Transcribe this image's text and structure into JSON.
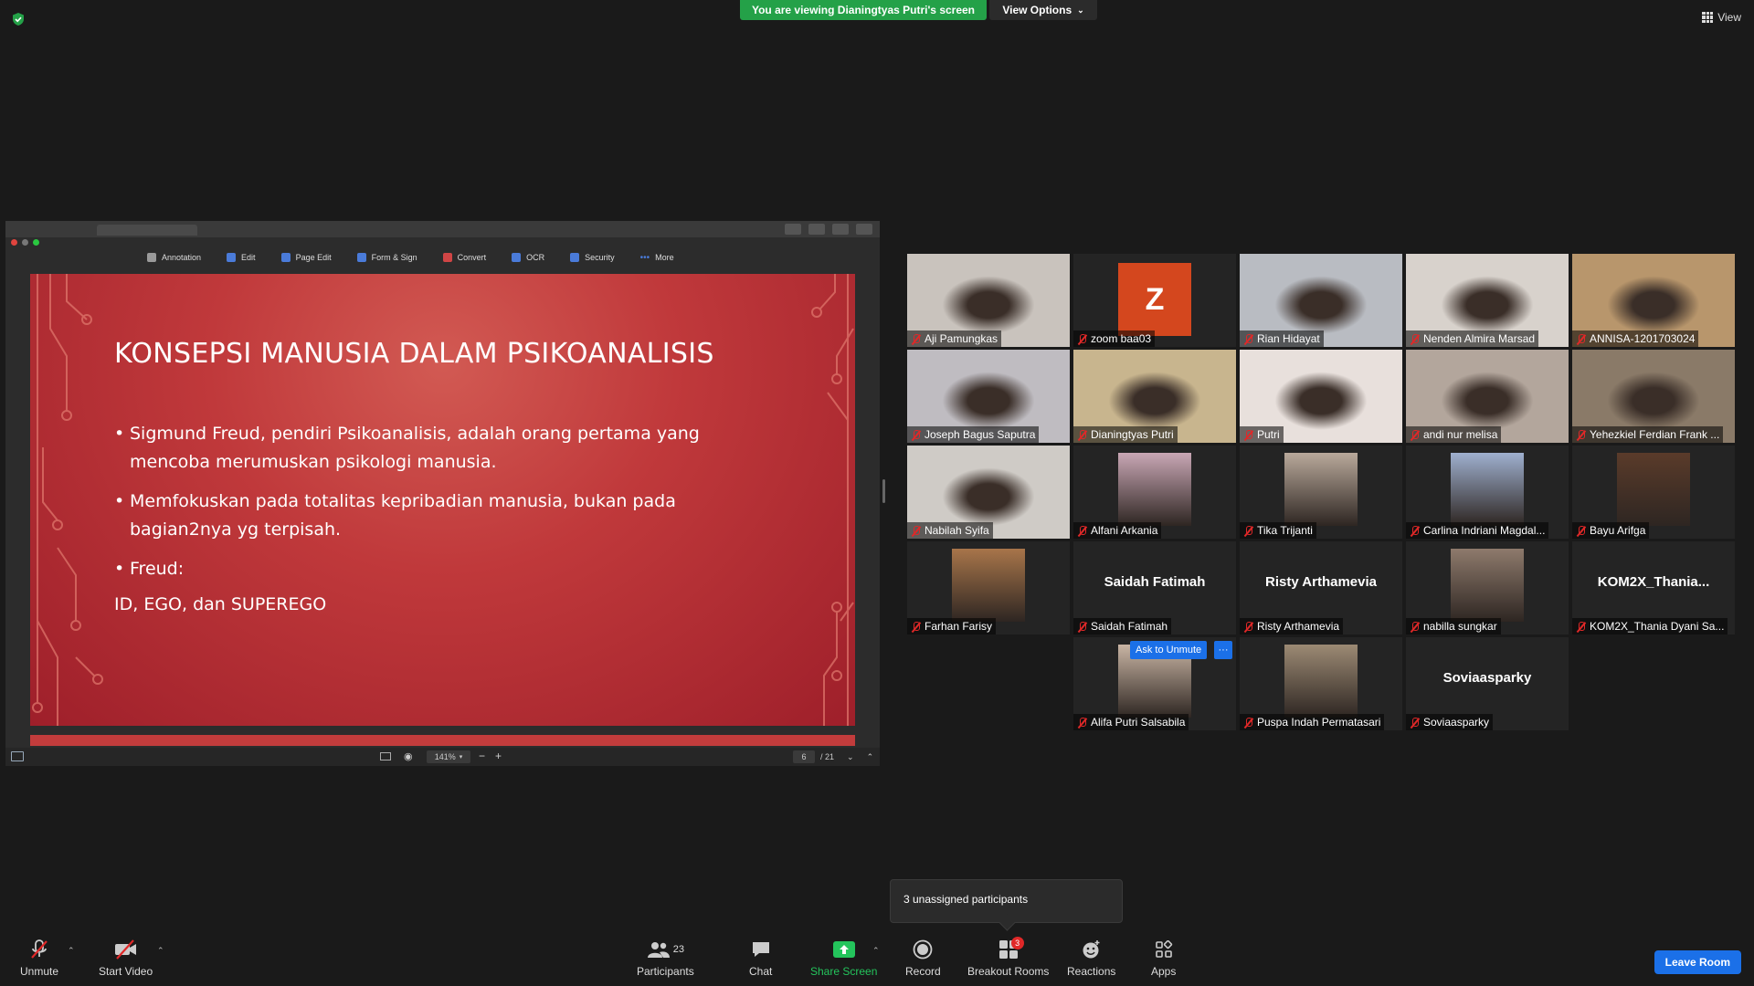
{
  "top": {
    "banner": "You are viewing Dianingtyas Putri's screen",
    "view_options": "View Options",
    "view": "View"
  },
  "share": {
    "toolbar": [
      "Annotation",
      "Edit",
      "Page Edit",
      "Form & Sign",
      "Convert",
      "OCR",
      "Security",
      "More"
    ],
    "slide": {
      "title": "KONSEPSI MANUSIA DALAM PSIKOANALISIS",
      "bullets": [
        "Sigmund Freud, pendiri Psikoanalisis, adalah orang pertama yang mencoba merumuskan psikologi manusia.",
        "Memfokuskan pada totalitas kepribadian manusia, bukan pada bagian2nya yg terpisah.",
        "Freud:"
      ],
      "line": "ID, EGO, dan SUPEREGO"
    },
    "status": {
      "zoom": "141%",
      "page_current": "6",
      "page_total": "/ 21"
    }
  },
  "participants": [
    {
      "name": "Aji Pamungkas",
      "kind": "video",
      "tone": "#c9c3bd"
    },
    {
      "name": "zoom baa03",
      "kind": "avatar",
      "letter": "Z"
    },
    {
      "name": "Rian Hidayat",
      "kind": "video",
      "tone": "#b9bcc2"
    },
    {
      "name": "Nenden Almira Marsad",
      "kind": "video",
      "tone": "#d8d2cc"
    },
    {
      "name": "ANNISA-1201703024",
      "kind": "video",
      "tone": "#b8966c"
    },
    {
      "name": "Joseph Bagus Saputra",
      "kind": "video",
      "tone": "#bfbcc1"
    },
    {
      "name": "Dianingtyas Putri",
      "kind": "video",
      "tone": "#c8b58e",
      "active": true
    },
    {
      "name": "Putri",
      "kind": "video",
      "tone": "#e8e0dc"
    },
    {
      "name": "andi nur melisa",
      "kind": "video",
      "tone": "#b3a69c"
    },
    {
      "name": "Yehezkiel Ferdian Frank ...",
      "kind": "video",
      "tone": "#8a7a68"
    },
    {
      "name": "Nabilah Syifa",
      "kind": "video",
      "tone": "#cfcbc6"
    },
    {
      "name": "Alfani Arkania",
      "kind": "photo",
      "tone": "#c9a7b5"
    },
    {
      "name": "Tika Trijanti",
      "kind": "photo",
      "tone": "#b9a99b"
    },
    {
      "name": "Carlina Indriani Magdal...",
      "kind": "photo",
      "tone": "#9fb0cf"
    },
    {
      "name": "Bayu Arifga",
      "kind": "photo",
      "tone": "#5a3b2a"
    },
    {
      "name": "Farhan Farisy",
      "kind": "photo",
      "tone": "#a8754a"
    },
    {
      "name": "Saidah Fatimah",
      "kind": "text",
      "big": "Saidah Fatimah"
    },
    {
      "name": "Risty Arthamevia",
      "kind": "text",
      "big": "Risty Arthamevia"
    },
    {
      "name": "nabilla sungkar",
      "kind": "photo",
      "tone": "#8e7a6c"
    },
    {
      "name": "KOM2X_Thania Dyani Sa...",
      "kind": "text",
      "big": "KOM2X_Thania..."
    },
    {
      "name": "Alifa Putri Salsabila",
      "kind": "photo",
      "tone": "#c9b5a4"
    },
    {
      "name": "Puspa Indah Permatasari",
      "kind": "photo",
      "tone": "#9c8a74"
    },
    {
      "name": "Soviaasparky",
      "kind": "text",
      "big": "Soviaasparky"
    }
  ],
  "hover": {
    "ask_unmute": "Ask to Unmute",
    "more": "···"
  },
  "unassigned": "3 unassigned participants",
  "toolbar": {
    "unmute": "Unmute",
    "start_video": "Start Video",
    "participants": "Participants",
    "participants_count": "23",
    "chat": "Chat",
    "share_screen": "Share Screen",
    "record": "Record",
    "breakout_rooms": "Breakout Rooms",
    "breakout_badge": "3",
    "reactions": "Reactions",
    "apps": "Apps",
    "leave": "Leave Room"
  },
  "colors": {
    "banner_green": "#24a148",
    "accent_blue": "#1b70e8",
    "mute_red": "#e02828",
    "active_speaker": "#e8df6c"
  }
}
